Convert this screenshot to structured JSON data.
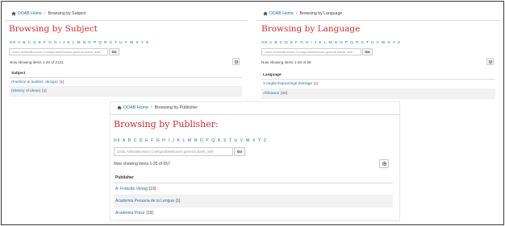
{
  "subject": {
    "breadcrumb_home": "DOAB Home",
    "breadcrumb_current": "Browsing by Subject",
    "title": "Browsing by Subject",
    "alpha": [
      "0-9",
      "A",
      "B",
      "C",
      "D",
      "E",
      "F",
      "G",
      "H",
      "I",
      "J",
      "K",
      "L",
      "M",
      "N",
      "O",
      "P",
      "Q",
      "R",
      "S",
      "T",
      "U",
      "V",
      "W",
      "X",
      "Y",
      "Z"
    ],
    "search_placeholder": "xmlui.ArtifactBrowser.ConfigurableBrowse.general.starts_with",
    "go_label": "Go",
    "showing": "Now showing items 1-20 of 2131",
    "column_header": "Subject",
    "rows": [
      {
        "label": "(Fashion & textiles: design)",
        "count": "[1]"
      },
      {
        "label": "(History of ideas)",
        "count": "[1]"
      }
    ]
  },
  "language": {
    "breadcrumb_home": "DOAB Home",
    "breadcrumb_current": "Browsing by Language",
    "title": "Browsing by Language",
    "alpha": [
      "0-9",
      "A",
      "B",
      "C",
      "D",
      "E",
      "F",
      "G",
      "H",
      "I",
      "J",
      "K",
      "L",
      "M",
      "N",
      "O",
      "P",
      "Q",
      "R",
      "S",
      "T",
      "U",
      "V",
      "W",
      "X",
      "Y",
      "Z"
    ],
    "search_placeholder": "xmlui.ArtifactBrowser.ConfigurableBrowse.general.starts_with",
    "go_label": "Go",
    "showing": "Now showing items 1-20 of 99",
    "column_header": "Language",
    "rows": [
      {
        "label": "3 englischsprachige beiträge",
        "count": "[1]"
      },
      {
        "label": "Afrikaans",
        "count": "[20]"
      }
    ]
  },
  "publisher": {
    "breadcrumb_home": "DOAB Home",
    "breadcrumb_current": "Browsing by Publisher",
    "title": "Browsing by Publisher:",
    "alpha": [
      "0-9",
      "A",
      "B",
      "C",
      "D",
      "E",
      "F",
      "G",
      "H",
      "I",
      "J",
      "K",
      "L",
      "M",
      "N",
      "O",
      "P",
      "Q",
      "R",
      "S",
      "T",
      "U",
      "V",
      "W",
      "X",
      "Y",
      "Z"
    ],
    "search_placeholder": "xmlui.ArtifactBrowser.ConfigurableBrowse.general.starts_with",
    "go_label": "Go",
    "showing": "Now showing items 1-20 of 657",
    "column_header": "Publisher",
    "rows": [
      {
        "label": "A. Francke Verlag",
        "count": "[19]"
      },
      {
        "label": "Academia Peruana de la Lengua",
        "count": "[1]"
      },
      {
        "label": "Academia Press",
        "count": "[39]"
      }
    ]
  },
  "icons": {
    "home": "home-icon",
    "settings": "gear-icon"
  },
  "colors": {
    "title": "#c9302c",
    "link": "#2a6db5",
    "row_alt": "#f2f2f2"
  }
}
